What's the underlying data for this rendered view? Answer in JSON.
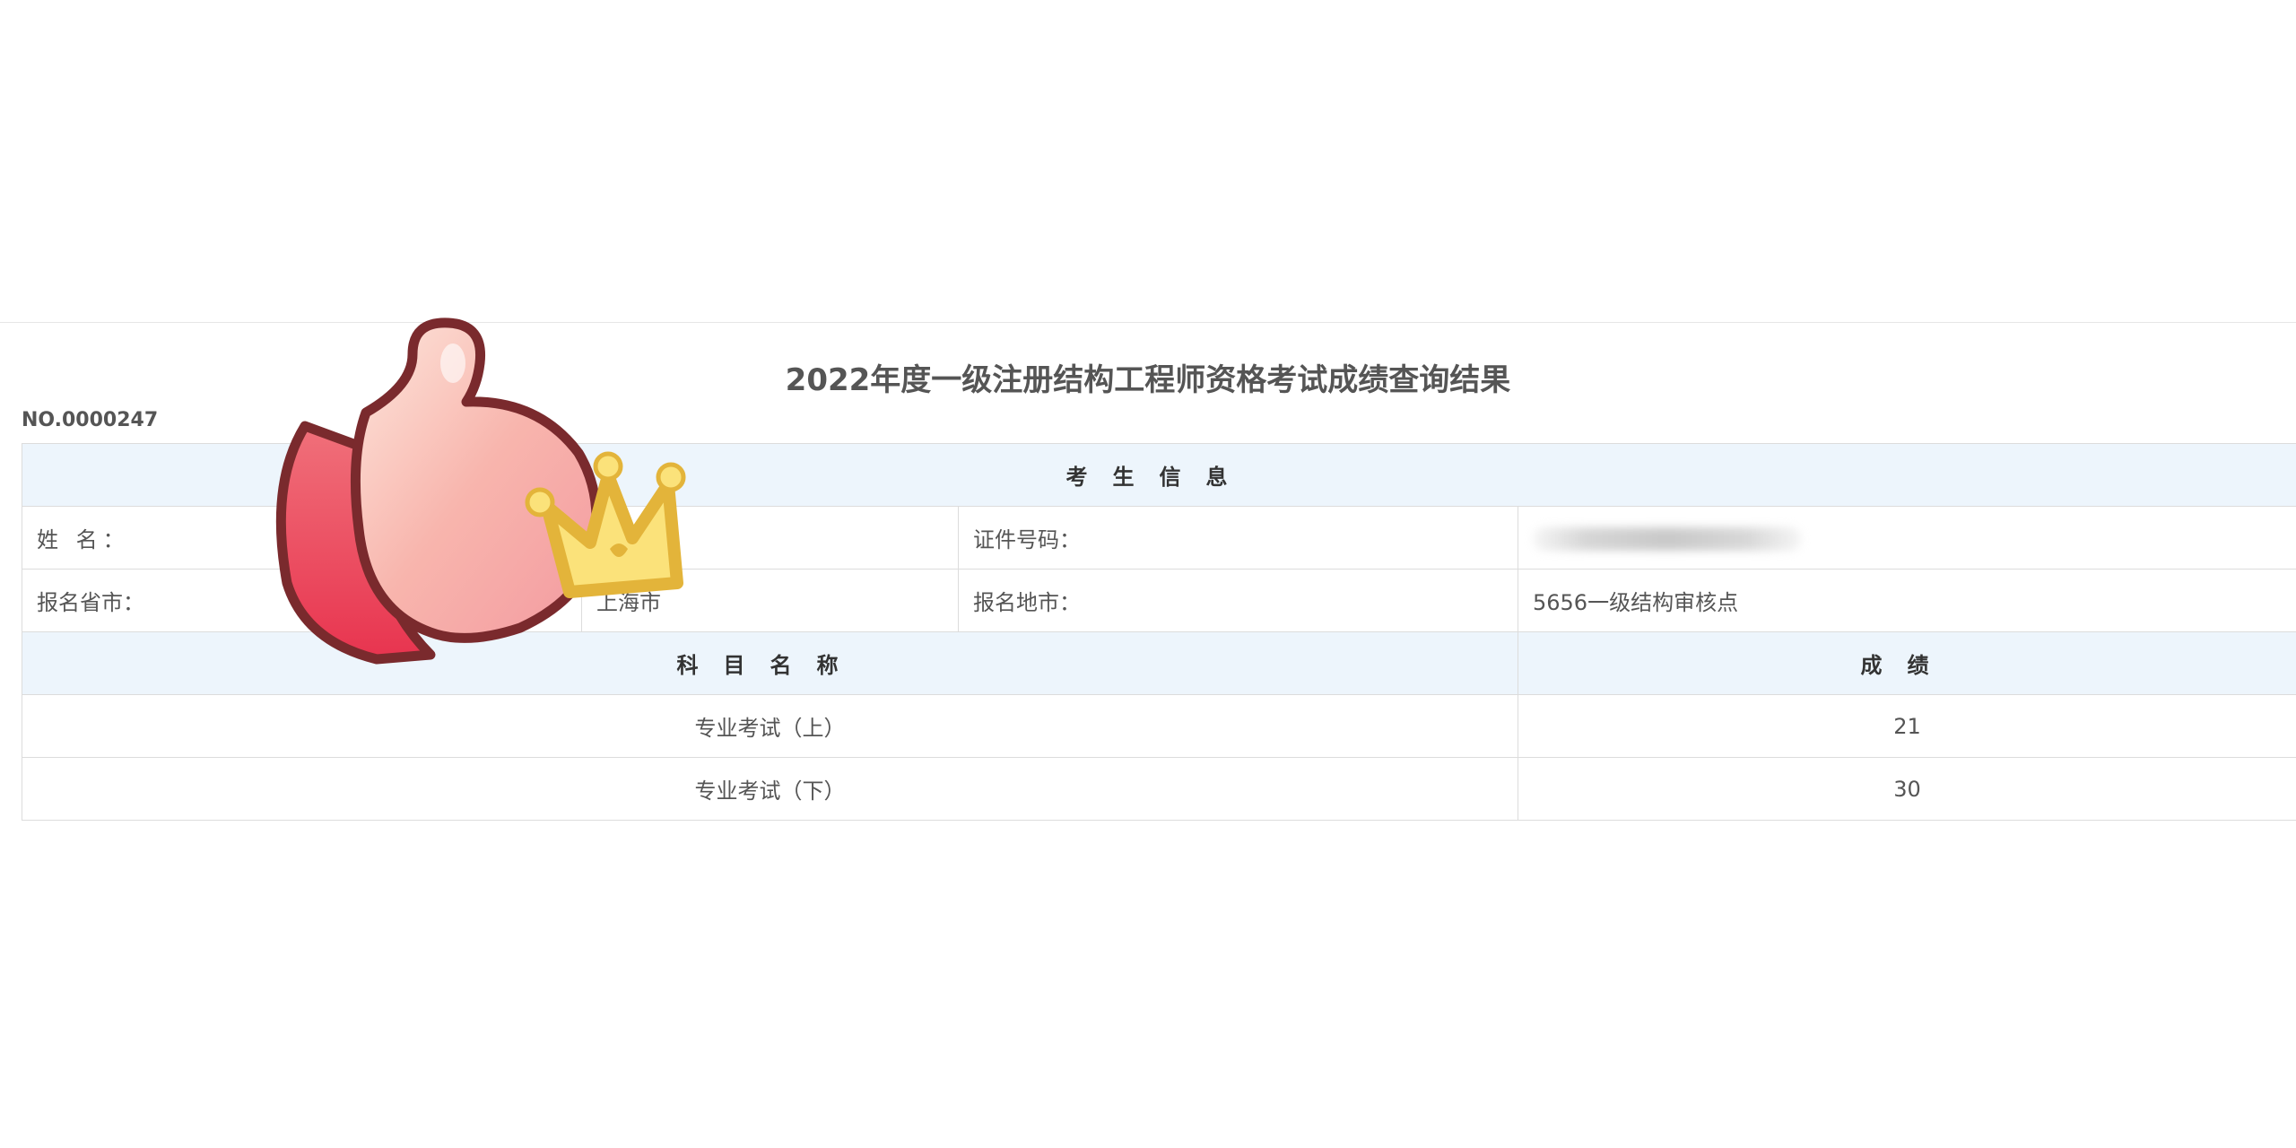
{
  "page": {
    "title": "2022年度一级注册结构工程师资格考试成绩查询结果",
    "record_no": "NO.0000247"
  },
  "candidate_section": {
    "heading": "考生信息",
    "name_label": "姓    名：",
    "id_label": "证件号码：",
    "province_label": "报名省市：",
    "province_value": "上海市",
    "site_label": "报名地市：",
    "site_value": "5656一级结构审核点"
  },
  "scores_section": {
    "subject_header": "科目名称",
    "score_header": "成绩",
    "rows": [
      {
        "subject": "专业考试（上）",
        "score": "21"
      },
      {
        "subject": "专业考试（下）",
        "score": "30"
      }
    ]
  },
  "sticker": {
    "icon": "thumbs-up-crown-sticker"
  }
}
